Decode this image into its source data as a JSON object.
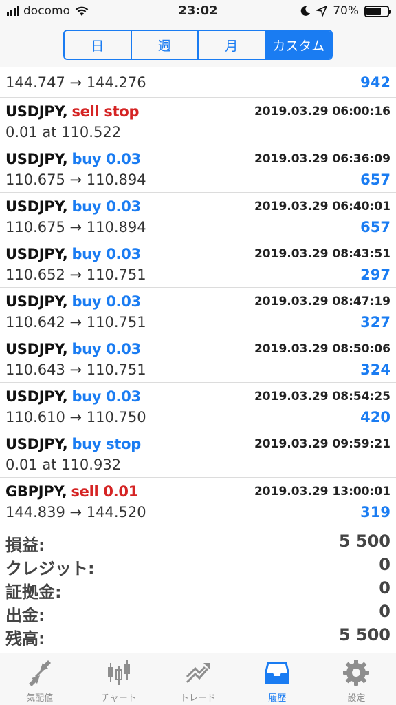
{
  "status_bar": {
    "carrier": "docomo",
    "time": "23:02",
    "battery": "70%",
    "battery_level": 0.7
  },
  "period_tabs": [
    {
      "label": "日",
      "active": false
    },
    {
      "label": "週",
      "active": false
    },
    {
      "label": "月",
      "active": false
    },
    {
      "label": "カスタム",
      "active": true
    }
  ],
  "first_row": {
    "prices": "144.747 → 144.276",
    "profit": "942"
  },
  "rows": [
    {
      "symbol": "USDJPY",
      "action": "sell stop",
      "side": "sell",
      "time": "2019.03.29 06:00:16",
      "detail": "0.01 at 110.522",
      "profit": ""
    },
    {
      "symbol": "USDJPY",
      "action": "buy 0.03",
      "side": "buy",
      "time": "2019.03.29 06:36:09",
      "detail": "110.675 → 110.894",
      "profit": "657"
    },
    {
      "symbol": "USDJPY",
      "action": "buy 0.03",
      "side": "buy",
      "time": "2019.03.29 06:40:01",
      "detail": "110.675 → 110.894",
      "profit": "657"
    },
    {
      "symbol": "USDJPY",
      "action": "buy 0.03",
      "side": "buy",
      "time": "2019.03.29 08:43:51",
      "detail": "110.652 → 110.751",
      "profit": "297"
    },
    {
      "symbol": "USDJPY",
      "action": "buy 0.03",
      "side": "buy",
      "time": "2019.03.29 08:47:19",
      "detail": "110.642 → 110.751",
      "profit": "327"
    },
    {
      "symbol": "USDJPY",
      "action": "buy 0.03",
      "side": "buy",
      "time": "2019.03.29 08:50:06",
      "detail": "110.643 → 110.751",
      "profit": "324"
    },
    {
      "symbol": "USDJPY",
      "action": "buy 0.03",
      "side": "buy",
      "time": "2019.03.29 08:54:25",
      "detail": "110.610 → 110.750",
      "profit": "420"
    },
    {
      "symbol": "USDJPY",
      "action": "buy stop",
      "side": "buy",
      "time": "2019.03.29 09:59:21",
      "detail": "0.01 at 110.932",
      "profit": ""
    },
    {
      "symbol": "GBPJPY",
      "action": "sell 0.01",
      "side": "sell",
      "time": "2019.03.29 13:00:01",
      "detail": "144.839 → 144.520",
      "profit": "319"
    }
  ],
  "summary": [
    {
      "label": "損益:",
      "value": "5 500"
    },
    {
      "label": "クレジット:",
      "value": "0"
    },
    {
      "label": "証拠金:",
      "value": "0"
    },
    {
      "label": "出金:",
      "value": "0"
    },
    {
      "label": "残高:",
      "value": "5 500"
    }
  ],
  "tabbar": [
    {
      "label": "気配値",
      "icon": "quotes-icon",
      "active": false
    },
    {
      "label": "チャート",
      "icon": "candlestick-chart-icon",
      "active": false
    },
    {
      "label": "トレード",
      "icon": "trade-icon",
      "active": false
    },
    {
      "label": "履歴",
      "icon": "history-inbox-icon",
      "active": true
    },
    {
      "label": "設定",
      "icon": "gear-icon",
      "active": false
    }
  ],
  "colors": {
    "accent": "#1a7cf2",
    "sell": "#d52424",
    "inactive": "#8e8e8e"
  }
}
